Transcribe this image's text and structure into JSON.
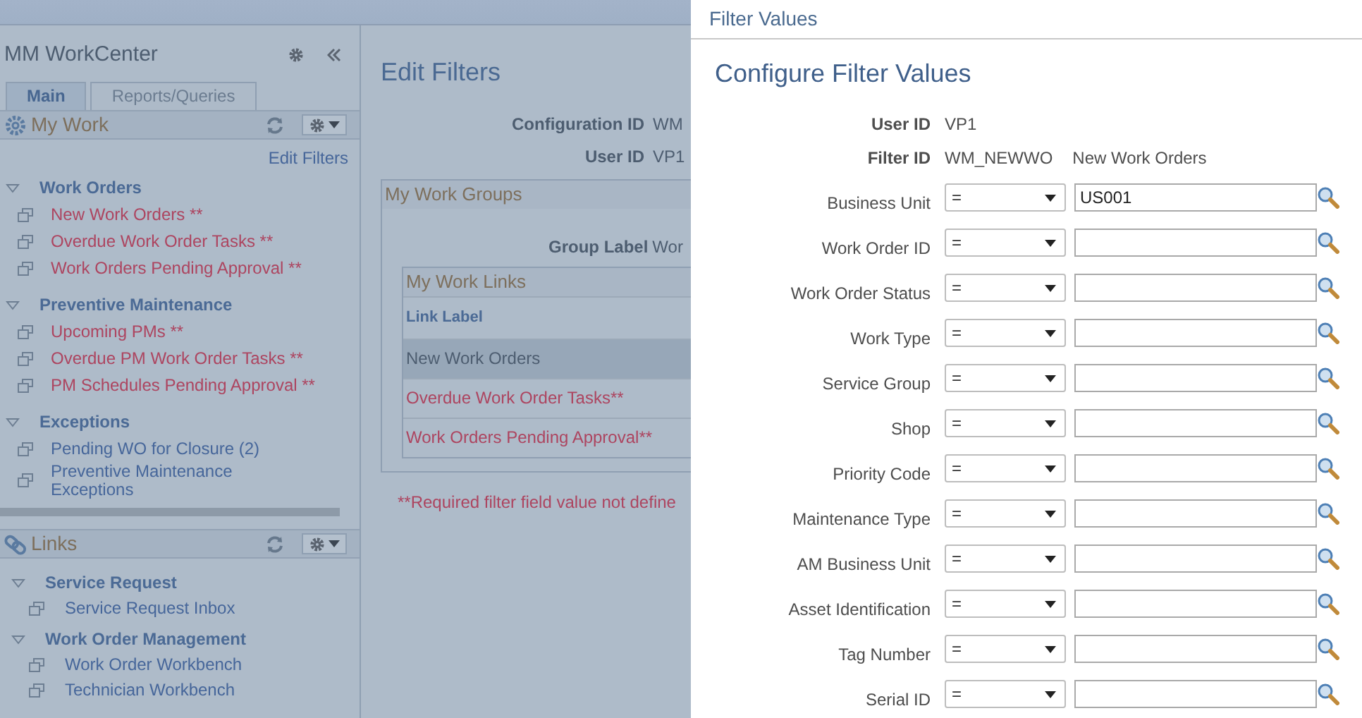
{
  "sidebar": {
    "title": "MM WorkCenter",
    "tabs": [
      {
        "label": "Main",
        "selected": true
      },
      {
        "label": "Reports/Queries",
        "selected": false
      }
    ],
    "pagelets": [
      {
        "title": "My Work",
        "kind": "work",
        "edit_link": "Edit Filters",
        "groups": [
          {
            "title": "Work Orders",
            "expanded": true,
            "items": [
              {
                "label": "New Work Orders **",
                "flagged": true
              },
              {
                "label": "Overdue Work Order Tasks **",
                "flagged": true
              },
              {
                "label": "Work Orders Pending Approval **",
                "flagged": true
              }
            ]
          },
          {
            "title": "Preventive Maintenance",
            "expanded": true,
            "items": [
              {
                "label": "Upcoming PMs **",
                "flagged": true
              },
              {
                "label": "Overdue PM Work Order Tasks **",
                "flagged": true
              },
              {
                "label": "PM Schedules Pending Approval **",
                "flagged": true
              }
            ]
          },
          {
            "title": "Exceptions",
            "expanded": true,
            "items": [
              {
                "label": "Pending WO for Closure (2)",
                "flagged": false
              },
              {
                "label": "Preventive Maintenance Exceptions",
                "flagged": false
              }
            ]
          }
        ]
      },
      {
        "title": "Links",
        "kind": "links",
        "groups": [
          {
            "title": "Service Request",
            "expanded": true,
            "items": [
              {
                "label": "Service Request Inbox",
                "flagged": false
              }
            ]
          },
          {
            "title": "Work Order Management",
            "expanded": true,
            "items": [
              {
                "label": "Work Order Workbench",
                "flagged": false
              },
              {
                "label": "Technician Workbench",
                "flagged": false
              }
            ]
          }
        ]
      }
    ]
  },
  "edit_filters": {
    "title": "Edit Filters",
    "fields": [
      {
        "label": "Configuration ID",
        "value": "WM"
      },
      {
        "label": "User ID",
        "value": "VP1"
      }
    ],
    "groups_box": {
      "title": "My Work Groups",
      "group_label": "Group Label",
      "group_value": "Wor",
      "links_box": {
        "title": "My Work Links",
        "column": "Link Label",
        "rows": [
          {
            "label": "New Work Orders",
            "selected": true,
            "flagged": false
          },
          {
            "label": "Overdue Work Order Tasks**",
            "selected": false,
            "flagged": true
          },
          {
            "label": "Work Orders Pending Approval**",
            "selected": false,
            "flagged": true
          }
        ]
      }
    },
    "note": "**Required filter field value not define"
  },
  "modal": {
    "title": "Filter Values",
    "heading": "Configure Filter Values",
    "info": [
      {
        "label": "User ID",
        "value": "VP1"
      },
      {
        "label": "Filter ID",
        "value": "WM_NEWWO",
        "description": "New Work Orders"
      }
    ],
    "filters": [
      {
        "label": "Business Unit",
        "operator": "=",
        "value": "US001"
      },
      {
        "label": "Work Order ID",
        "operator": "="
      },
      {
        "label": "Work Order Status",
        "operator": "="
      },
      {
        "label": "Work Type",
        "operator": "="
      },
      {
        "label": "Service Group",
        "operator": "="
      },
      {
        "label": "Shop",
        "operator": "="
      },
      {
        "label": "Priority Code",
        "operator": "="
      },
      {
        "label": "Maintenance Type",
        "operator": "="
      },
      {
        "label": "AM Business Unit",
        "operator": "="
      },
      {
        "label": "Asset Identification",
        "operator": "="
      },
      {
        "label": "Tag Number",
        "operator": "="
      },
      {
        "label": "Serial ID",
        "operator": "="
      }
    ]
  }
}
